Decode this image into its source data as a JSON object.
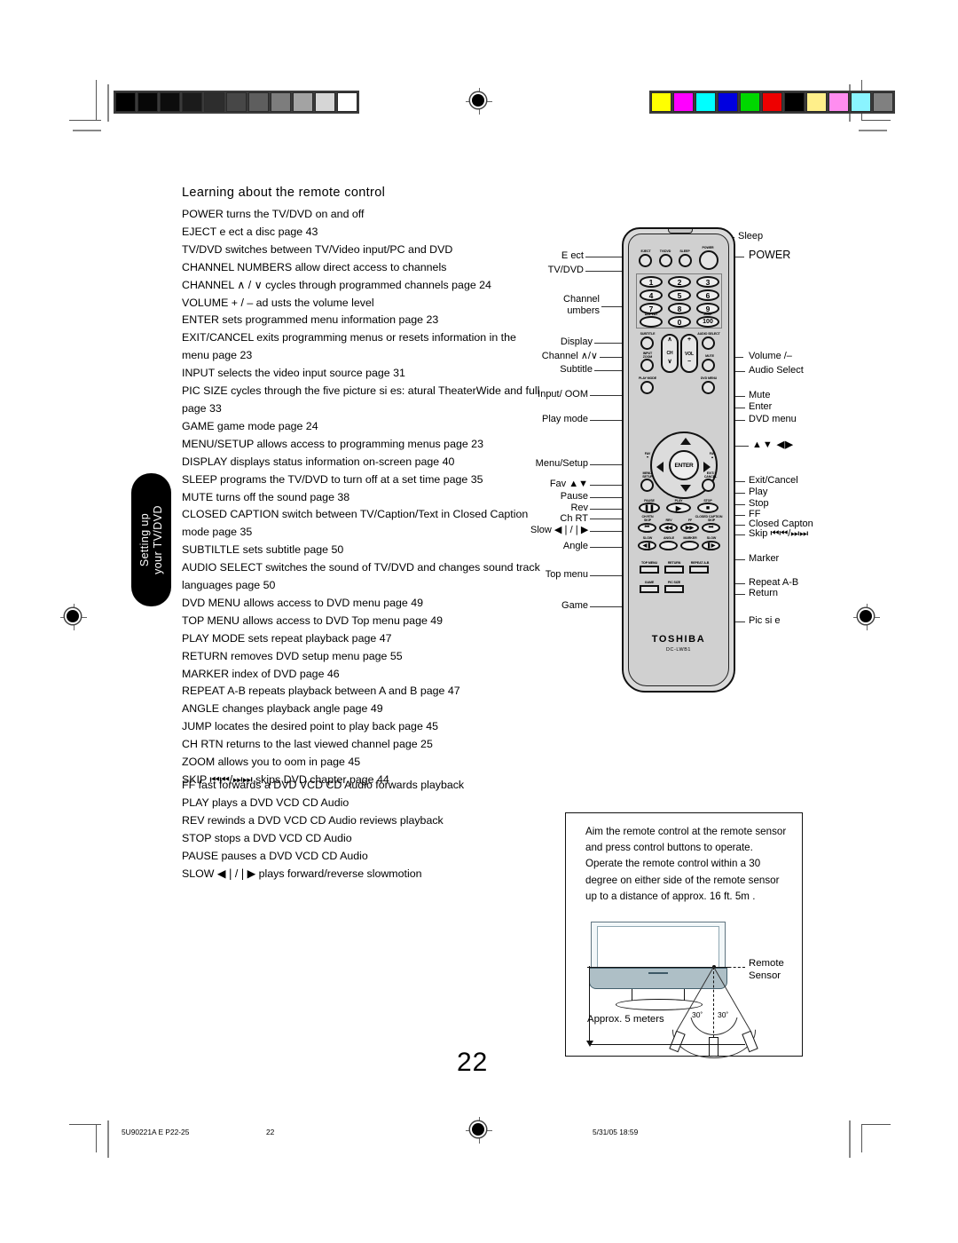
{
  "document": {
    "heading": "Learning about the remote control",
    "page_number": "22",
    "side_tab": "Setting up\nyour TV/DVD"
  },
  "side_tab": {
    "line1": "Setting up",
    "line2": "your TV/DVD"
  },
  "descriptions_primary": [
    "POWER turns the TV/DVD on and off",
    "EJECT e ect a disc  page 43",
    "TV/DVD switches between TV/Video input/PC and DVD",
    "CHANNEL NUMBERS allow direct access to channels",
    "CHANNEL ∧ / ∨ cycles through programmed channels  page 24",
    "VOLUME + / – ad usts the volume level",
    "ENTER sets programmed menu information  page 23",
    "EXIT/CANCEL exits programming menus or resets information in the menu  page 23",
    "INPUT selects the video input source  page 31",
    "PIC SIZE cycles through the five picture si es:  atural  TheaterWide and full  page 33",
    "GAME game mode  page 24",
    "MENU/SETUP allows access to programming menus  page 23",
    "DISPLAY displays status information on-screen  page 40",
    "SLEEP programs the TV/DVD to turn off at a set time  page 35",
    "MUTE turns off the sound  page 38",
    "CLOSED CAPTION switch between TV/Caption/Text in Closed Caption mode  page 35",
    "SUBTILTLE sets subtitle  page 50",
    "AUDIO SELECT switches the sound of TV/DVD and changes sound track languages  page 50",
    "DVD MENU allows access to DVD menu  page 49",
    "TOP MENU allows access to DVD Top menu  page 49",
    "PLAY MODE sets repeat playback  page 47",
    "RETURN removes DVD setup menu  page 55",
    "MARKER index of DVD  page 46",
    "REPEAT A-B repeats playback between A and B  page 47",
    "ANGLE changes playback angle  page 49",
    "JUMP locates the desired point to play back  page 45",
    "CH RTN returns to the last viewed channel  page 25",
    "ZOOM allows you to  oom in  page 45",
    "SKIP ⏮⏮/⏭⏭ skips DVD chapter  page 44"
  ],
  "descriptions_secondary": [
    "FF fast forwards a DVD  VCD  CD Audio  forwards playback",
    "PLAY plays a DVD  VCD  CD Audio",
    "REV rewinds a DVD  VCD  CD Audio  reviews playback",
    "STOP stops a DVD  VCD  CD Audio",
    "PAUSE pauses a DVD  VCD  CD Audio",
    "SLOW ◀❘/❘▶ plays forward/reverse slowmotion"
  ],
  "remote": {
    "brand": "TOSHIBA",
    "model": "DC-LWB1",
    "button_captions": {
      "eject": "EJECT",
      "tvdvd": "TV/DVD",
      "sleep": "SLEEP",
      "power": "POWER",
      "display": "DISPLAY",
      "jump": "JUMP",
      "subtitle": "SUBTITLE",
      "audio_select": "AUDIO SELECT",
      "input_zoom": "INPUT\nZOOM",
      "ch": "CH",
      "vol": "VOL",
      "mute": "MUTE",
      "play_mode": "PLAY MODE",
      "dvd_menu": "DVD MENU",
      "fav_down": "FAV",
      "fav_up": "FAV",
      "menu_setup": "MENU/\nSETUP",
      "exit_cancel": "EXIT/\nCANCEL",
      "enter": "ENTER",
      "pause": "PAUSE",
      "play": "PLAY",
      "stop": "STOP",
      "ch_rtn": "CH RTN",
      "closed_caption": "CLOSED CAPTION",
      "skip_back": "SKIP",
      "rev": "REV",
      "ff": "FF",
      "skip_fwd": "SKIP",
      "slow_back": "SLOW",
      "angle": "ANGLE",
      "marker": "MARKER",
      "slow_fwd": "SLOW",
      "top_menu": "TOP MENU",
      "return": "RETURN",
      "repeat_ab": "REPEAT A-B",
      "game": "GAME",
      "pic_size": "PIC SIZE"
    },
    "keypad": [
      "1",
      "2",
      "3",
      "4",
      "5",
      "6",
      "7",
      "8",
      "9",
      "0",
      "100"
    ],
    "labels_left": [
      "E ect",
      "TV/DVD",
      "Channel\n umbers",
      "Display",
      "Channel ∧/∨",
      "Subtitle",
      "Input/  OOM",
      "Play mode",
      "Menu/Setup",
      "Fav ▲▼",
      "Pause",
      "Rev",
      "Ch RT",
      "Slow ◀❘/❘▶",
      "Angle",
      "Top menu",
      "Game"
    ],
    "labels_right": [
      "Sleep",
      "POWER",
      "Volume  /–",
      "Audio Select",
      "Mute",
      "Enter",
      "DVD menu",
      "▲▼ ◀▶",
      "Exit/Cancel",
      "Play",
      "Stop",
      "FF",
      "Closed Capton",
      "Skip ⏮⏮/⏭⏭",
      "Marker",
      "Repeat A-B",
      "Return",
      "Pic si e"
    ],
    "label_text": {
      "eject": "E ect",
      "tvdvd": "TV/DVD",
      "channel_numbers_l1": "Channel",
      "channel_numbers_l2": " umbers",
      "display": "Display",
      "channel_updown": "Channel ∧/∨",
      "subtitle": "Subtitle",
      "input_zoom": "Input/  OOM",
      "play_mode": "Play mode",
      "menu_setup": "Menu/Setup",
      "fav": "Fav ▲▼",
      "pause": "Pause",
      "rev": "Rev",
      "ch_rtn": "Ch RT",
      "slow": "Slow ◀❘/❘▶",
      "angle": "Angle",
      "top_menu": "Top menu",
      "game": "Game",
      "sleep": "Sleep",
      "power": "POWER",
      "volume": "Volume  /–",
      "audio_select": "Audio Select",
      "mute": "Mute",
      "enter": "Enter",
      "dvd_menu": "DVD menu",
      "arrows": "▲▼ ◀▶",
      "exit_cancel": "Exit/Cancel",
      "play": "Play",
      "stop": "Stop",
      "ff": "FF",
      "closed_caption": "Closed Capton",
      "skip": "Skip ⏮⏮/⏭⏭",
      "marker": "Marker",
      "repeat_ab": "Repeat A-B",
      "return": "Return",
      "pic_size": "Pic si e"
    }
  },
  "sensor_panel": {
    "paragraph1": "Aim the remote control at the remote sensor and press control buttons to operate.",
    "paragraph2": "Operate the remote control within a 30 degree on either side of the remote sensor  up to a distance of approx. 16 ft.  5m .",
    "distance_label": "Approx. 5 meters",
    "sensor_label_l1": "Remote",
    "sensor_label_l2": "Sensor",
    "angle_left": "30˚",
    "angle_right": "30˚"
  },
  "footer": {
    "file_code": "5U90221A E P22-25",
    "page": "22",
    "timestamp": "5/31/05 18:59"
  },
  "calibration": {
    "gray_steps": [
      "#000000",
      "#070707",
      "#0d0d0d",
      "#1b1b1b",
      "#2d2d2d",
      "#474747",
      "#5e5e5e",
      "#7d7d7d",
      "#a3a3a3",
      "#d6d6d6",
      "#ffffff"
    ],
    "color_bars": [
      "#ffff00",
      "#ff00ff",
      "#00ffff",
      "#0000e0",
      "#00d800",
      "#ee0000",
      "#000000",
      "#ffef8a",
      "#ff8df0",
      "#8af4ff",
      "#808080"
    ]
  }
}
